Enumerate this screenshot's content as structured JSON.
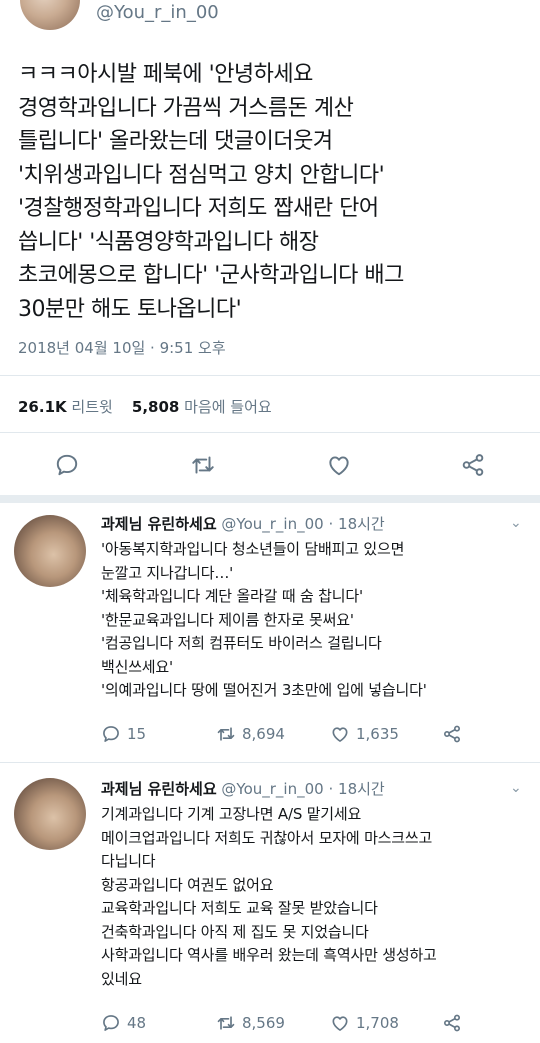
{
  "main_tweet": {
    "handle": "@You_r_in_00",
    "lines": [
      "ㅋㅋㅋ아시발 페북에 '안녕하세요",
      "경영학과입니다 가끔씩 거스름돈 계산",
      "틀립니다' 올라왔는데 댓글이더웃겨",
      "'치위생과입니다 점심먹고 양치 안합니다'",
      "'경찰행정학과입니다 저희도 짭새란 단어",
      "씁니다' '식품영양학과입니다 해장",
      "초코에몽으로 합니다' '군사학과입니다 배그",
      "30분만 해도 토나옵니다'"
    ],
    "timestamp": "2018년 04월 10일 · 9:51 오후",
    "retweet_count": "26.1K",
    "retweet_label": "리트윗",
    "like_count": "5,808",
    "like_label": "마음에 들어요",
    "actions": [
      "reply-icon",
      "retweet-icon",
      "like-icon",
      "share-icon"
    ]
  },
  "replies": [
    {
      "name": "과제님 유린하세요",
      "handle": "@You_r_in_00",
      "time": "· 18시간",
      "lines": [
        "'아동복지학과입니다 청소년들이 담배피고 있으면",
        "눈깔고 지나갑니다…'",
        "'체육학과입니다 계단 올라갈 때 숨 찹니다'",
        "'한문교육과입니다 제이름 한자로 못써요'",
        "'컴공입니다 저희 컴퓨터도 바이러스 걸립니다",
        "백신쓰세요'",
        "'의예과입니다 땅에 떨어진거 3초만에 입에 넣습니다'"
      ],
      "reply_count": "15",
      "retweet_count": "8,694",
      "like_count": "1,635"
    },
    {
      "name": "과제님 유린하세요",
      "handle": "@You_r_in_00",
      "time": "· 18시간",
      "lines": [
        "기계과입니다 기계 고장나면 A/S 맡기세요",
        "메이크업과입니다 저희도 귀찮아서 모자에 마스크쓰고",
        "다닙니다",
        "항공과입니다 여권도 없어요",
        "교육학과입니다 저희도 교육 잘못 받았습니다",
        "건축학과입니다 아직 제 집도 못 지었습니다",
        "사학과입니다 역사를 배우러 왔는데 흑역사만 생성하고",
        "있네요"
      ],
      "reply_count": "48",
      "retweet_count": "8,569",
      "like_count": "1,708"
    }
  ],
  "colors": {
    "text": "#14171a",
    "muted": "#657786",
    "divider": "#e1e8ed"
  }
}
